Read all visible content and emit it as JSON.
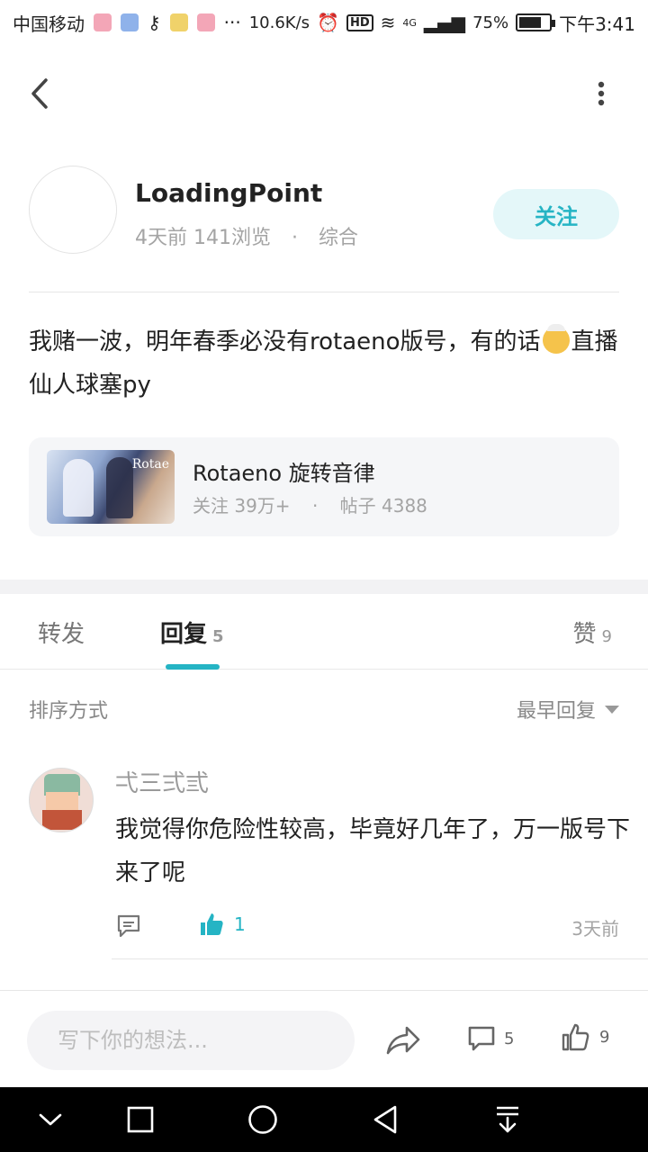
{
  "status_bar": {
    "carrier": "中国移动",
    "net_speed": "10.6K/s",
    "network": "4G",
    "battery": "75%",
    "battery_level": 0.75,
    "time": "下午3:41"
  },
  "post": {
    "author_name": "LoadingPoint",
    "time_ago": "4天前",
    "views": "141浏览",
    "separator": "·",
    "category": "综合",
    "follow_label": "关注",
    "text_part1": "我赌一波，明年春季必没有rotaeno版号，有的话",
    "text_part2": "直播仙人球塞py"
  },
  "topic": {
    "thumb_text": "Rotae",
    "title": "Rotaeno 旋转音律",
    "followers": "关注 39万+",
    "separator": "·",
    "posts": "帖子 4388"
  },
  "tabs": {
    "repost": "转发",
    "reply": "回复",
    "reply_count": "5",
    "like": "赞",
    "like_count": "9"
  },
  "sort": {
    "label": "排序方式",
    "value": "最早回复"
  },
  "comments": [
    {
      "username": "弌三弍弎",
      "text": "我觉得你危险性较高，毕竟好几年了，万一版号下来了呢",
      "like_count": "1",
      "time": "3天前"
    }
  ],
  "bottom_bar": {
    "input_placeholder": "写下你的想法...",
    "comment_count": "5",
    "like_count": "9"
  },
  "colors": {
    "accent": "#25b4c4",
    "follow_bg": "#e4f7f9",
    "muted_text": "#a4a4a4"
  },
  "icons": [
    "back-icon",
    "more-vertical-icon",
    "reply-icon",
    "thumbs-up-icon",
    "share-icon",
    "comment-icon",
    "chevron-down-icon",
    "square-icon",
    "circle-icon",
    "triangle-back-icon",
    "download-tray-icon"
  ]
}
